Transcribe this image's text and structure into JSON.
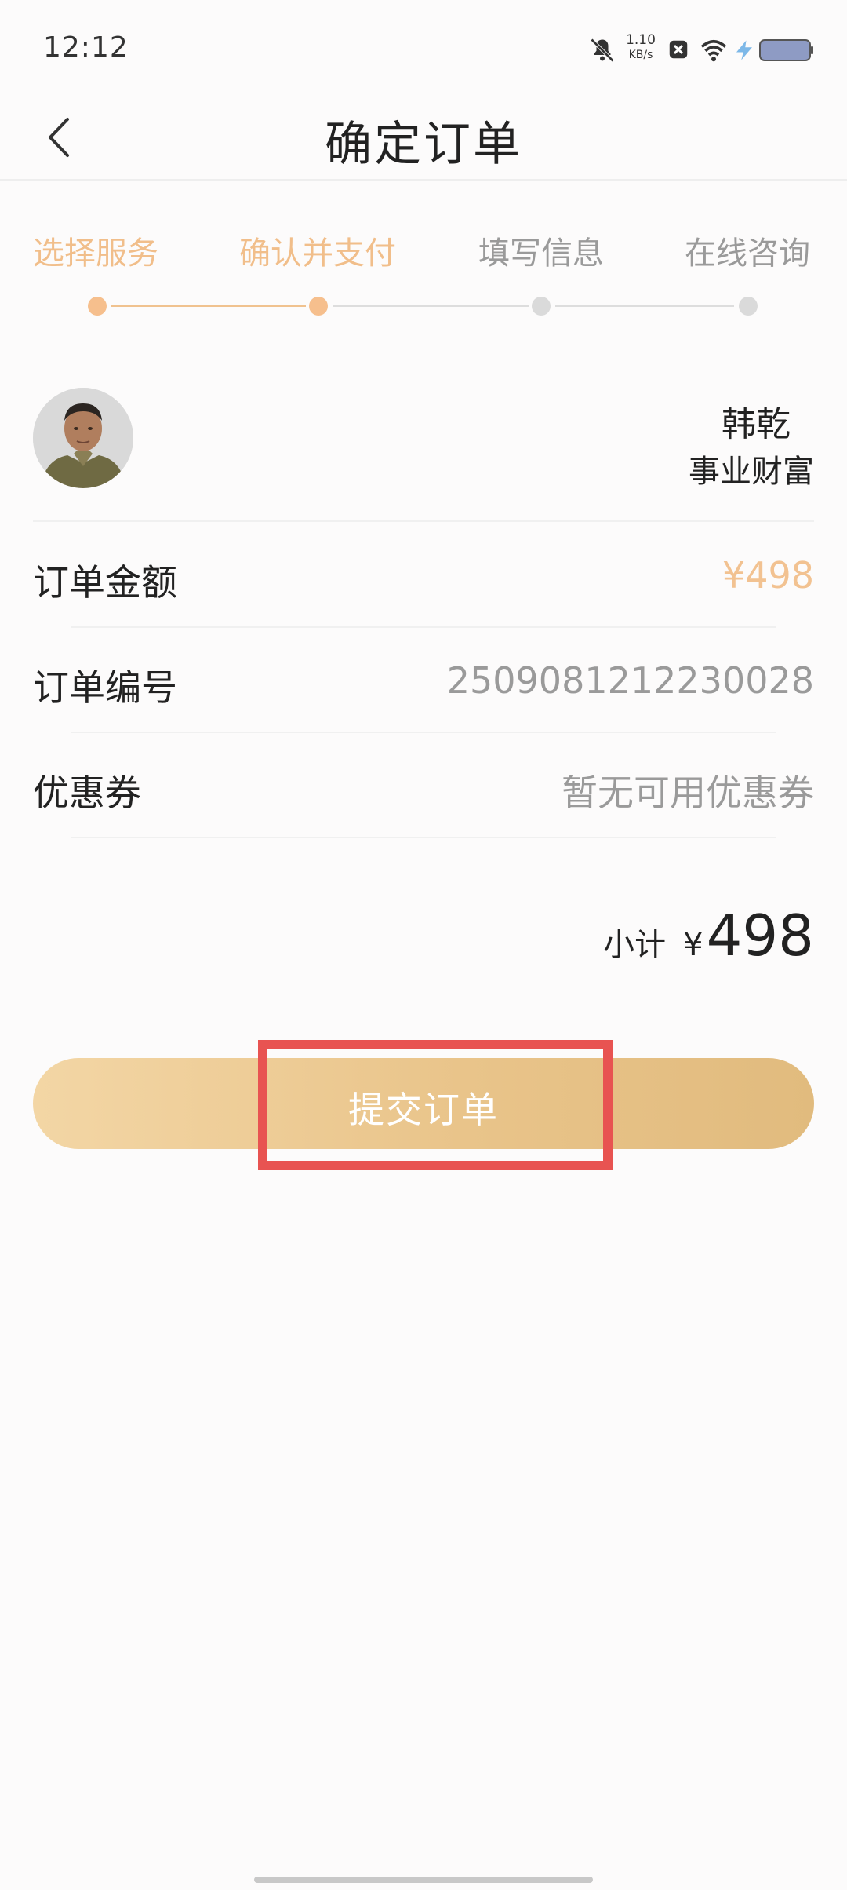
{
  "status_bar": {
    "time": "12:12",
    "net_speed_value": "1.10",
    "net_speed_unit": "KB/s"
  },
  "nav": {
    "title": "确定订单"
  },
  "steps": [
    {
      "label": "选择服务",
      "active": true
    },
    {
      "label": "确认并支付",
      "active": true
    },
    {
      "label": "填写信息",
      "active": false
    },
    {
      "label": "在线咨询",
      "active": false
    }
  ],
  "provider": {
    "name": "韩乾",
    "service": "事业财富"
  },
  "order": {
    "amount_label": "订单金额",
    "amount_value": "¥498",
    "number_label": "订单编号",
    "number_value": "2509081212230028",
    "coupon_label": "优惠券",
    "coupon_value": "暂无可用优惠券"
  },
  "subtotal": {
    "label": "小计",
    "currency": "¥",
    "amount": "498"
  },
  "submit": {
    "label": "提交订单"
  },
  "colors": {
    "accent": "#f1be8a",
    "button_gradient_start": "#f3d6a5",
    "button_gradient_end": "#e1bb7e",
    "highlight": "#e85351"
  }
}
